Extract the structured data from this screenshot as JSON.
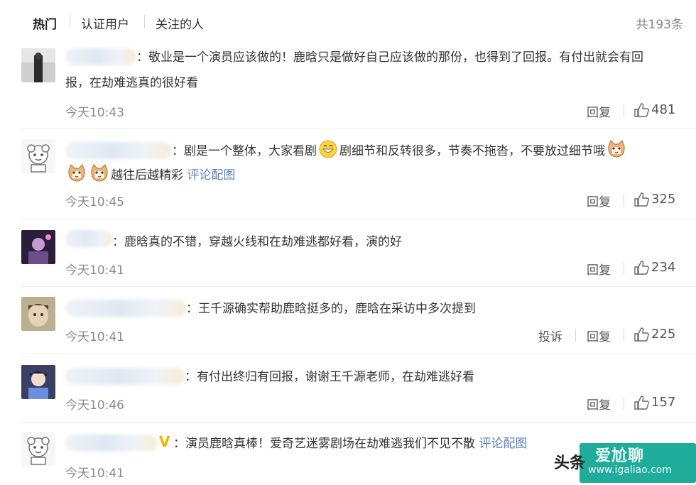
{
  "tabs": [
    {
      "label": "热门",
      "active": true
    },
    {
      "label": "认证用户",
      "active": false
    },
    {
      "label": "关注的人",
      "active": false
    }
  ],
  "total_count": "共193条",
  "actions": {
    "reply": "回复",
    "report": "投诉"
  },
  "comments": [
    {
      "text_line1": "：敬业是一个演员应该做的！鹿晗只是做好自己应该做的那份，也得到了回报。有付出就会有回",
      "text_line2": "报，在劫难逃真的很好看",
      "time": "今天10:43",
      "likes": "481"
    },
    {
      "text_a": "：剧是一个整体，大家看剧",
      "text_b": "剧细节和反转很多，节奏不拖沓，不要放过细节哦",
      "text_c": "越往后越精彩",
      "link": "评论配图",
      "time": "今天10:45",
      "likes": "325"
    },
    {
      "text": "：鹿晗真的不错，穿越火线和在劫难逃都好看，演的好",
      "time": "今天10:41",
      "likes": "234"
    },
    {
      "text": "：王千源确实帮助鹿晗挺多的，鹿晗在采访中多次提到",
      "time": "今天10:41",
      "likes": "225"
    },
    {
      "text": "：有付出终归有回报，谢谢王千源老师，在劫难逃好看",
      "time": "今天10:46",
      "likes": "157"
    },
    {
      "verified_mark": "V",
      "text": "：演员鹿晗真棒！爱奇艺迷雾剧场在劫难逃我们不见不散",
      "link": "评论配图",
      "time": "今天10:41"
    }
  ],
  "watermark": {
    "source": "头条",
    "site": "爱尬聊",
    "url": "www.igaliao.com"
  },
  "colors": {
    "link": "#5b82b8",
    "meta": "#8a8a8a",
    "badge": "#f1b400"
  }
}
